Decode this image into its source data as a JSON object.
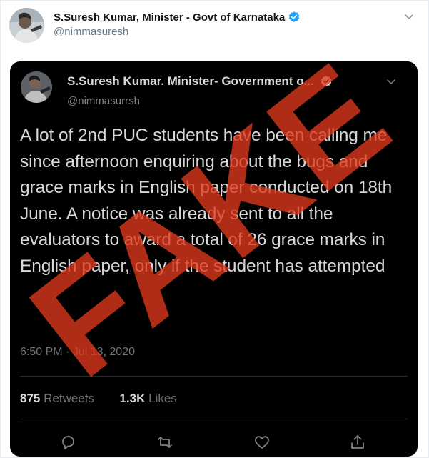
{
  "tweet": {
    "author_name": "S.Suresh Kumar, Minister - Govt of Karnataka",
    "author_handle": "@nimmasuresh"
  },
  "embedded_screenshot": {
    "author_name": "S.Suresh Kumar. Minister- Government o...",
    "author_handle": "@nimmasurrsh",
    "text": "A lot of 2nd PUC students have been calling me since afternoon enquiring about the bugs and grace marks in English paper conducted on 18th June. A notice was already sent to all the evaluators to award a total of 26 grace marks in English paper, only if the student has attempted",
    "timestamp": "6:50 PM · Jul 13, 2020",
    "retweets_count": "875",
    "retweets_label": "Retweets",
    "likes_count": "1.3K",
    "likes_label": "Likes"
  },
  "stamp": {
    "text": "FAKE",
    "color": "#e0391e"
  },
  "icons": {
    "verified": "verified-badge-icon",
    "caret": "chevron-down-icon",
    "reply": "reply-icon",
    "retweet": "retweet-icon",
    "like": "heart-icon",
    "share": "share-icon"
  },
  "colors": {
    "verified_blue": "#1da1f2",
    "embed_bg": "#000000"
  }
}
